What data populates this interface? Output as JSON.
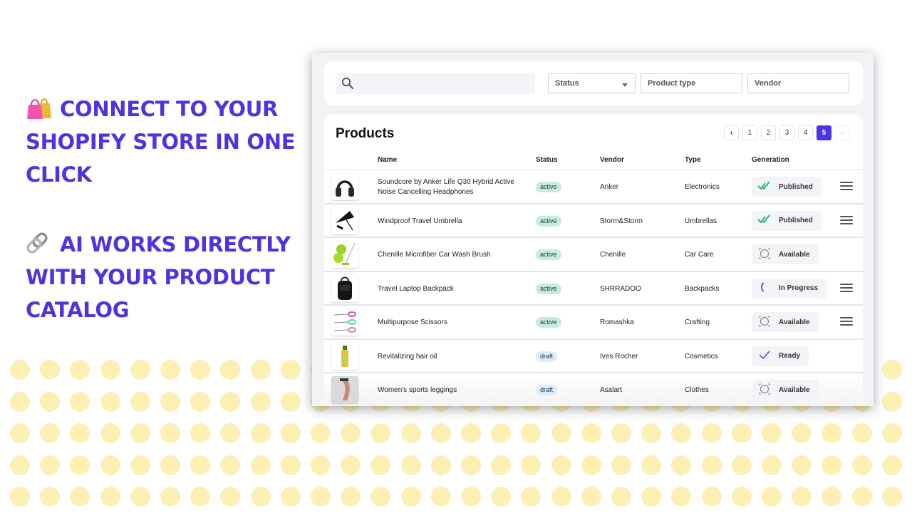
{
  "promo": {
    "headline_1": "CONNECT TO YOUR SHOPIFY STORE IN ONE CLICK",
    "headline_1_icon": "shopping-bags-icon",
    "headline_2": "AI WORKS DIRECTLY WITH YOUR PRODUCT CATALOG",
    "headline_2_icon": "link-icon",
    "accent_color": "#4c35e0",
    "dot_color": "#fcf0b5"
  },
  "filters": {
    "search_placeholder": "",
    "search_icon": "search-icon",
    "status_label": "Status",
    "product_type_label": "Product type",
    "vendor_label": "Vendor"
  },
  "products": {
    "title": "Products",
    "pagination": {
      "prev": "‹",
      "pages": [
        "1",
        "2",
        "3",
        "4",
        "5"
      ],
      "current": "5",
      "next": "›"
    },
    "columns": {
      "name": "Name",
      "status": "Status",
      "vendor": "Vendor",
      "type": "Type",
      "generation": "Generation"
    },
    "rows": [
      {
        "thumb": "headphones",
        "name": "Soundcore by Anker Life Q30 Hybrid Active Noise Cancelling Headphones",
        "status": "active",
        "vendor": "Anker",
        "type": "Electronics",
        "generation": "Published",
        "gen_icon": "double-check-icon",
        "has_menu": true
      },
      {
        "thumb": "umbrella",
        "name": "Windproof Travel Umbrella",
        "status": "active",
        "vendor": "Storm&Storm",
        "type": "Umbrellas",
        "generation": "Published",
        "gen_icon": "double-check-icon",
        "has_menu": true
      },
      {
        "thumb": "car-wash-brush",
        "name": "Chenille Microfiber Car Wash Brush",
        "status": "active",
        "vendor": "Chenille",
        "type": "Car Care",
        "generation": "Available",
        "gen_icon": "circle-focus-icon",
        "has_menu": false
      },
      {
        "thumb": "backpack",
        "name": "Travel Laptop Backpack",
        "status": "active",
        "vendor": "SHRRADOO",
        "type": "Backpacks",
        "generation": "In Progress",
        "gen_icon": "spinner-icon",
        "has_menu": true
      },
      {
        "thumb": "scissors",
        "name": "Multipurpose Scissors",
        "status": "active",
        "vendor": "Romashka",
        "type": "Crafting",
        "generation": "Available",
        "gen_icon": "circle-focus-icon",
        "has_menu": true
      },
      {
        "thumb": "hair-oil",
        "name": "Revitalizing hair oil",
        "status": "draft",
        "vendor": "Ives Rocher",
        "type": "Cosmetics",
        "generation": "Ready",
        "gen_icon": "check-icon",
        "has_menu": false
      },
      {
        "thumb": "leggings",
        "name": "Women's sports leggings",
        "status": "draft",
        "vendor": "Asalart",
        "type": "Clothes",
        "generation": "Available",
        "gen_icon": "circle-focus-icon",
        "has_menu": false
      }
    ]
  }
}
